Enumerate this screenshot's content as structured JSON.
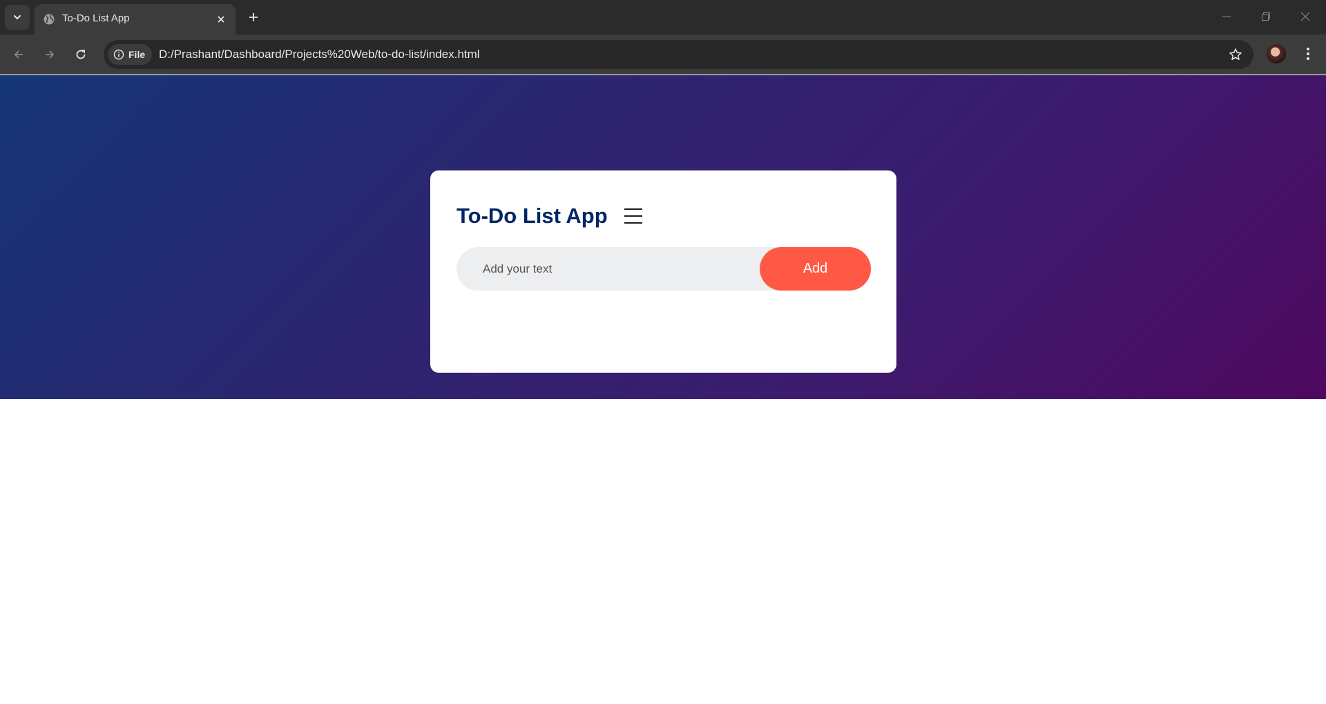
{
  "browser": {
    "tab_title": "To-Do List App",
    "site_chip_label": "File",
    "url": "D:/Prashant/Dashboard/Projects%20Web/to-do-list/index.html",
    "icons": {
      "tab_search": "chevron-down-icon",
      "favicon": "globe-icon",
      "tab_close": "close-icon",
      "new_tab": "plus-icon",
      "back": "arrow-left-icon",
      "forward": "arrow-right-icon",
      "reload": "reload-icon",
      "site_info": "info-icon",
      "bookmark": "star-icon",
      "menu": "kebab-menu-icon",
      "minimize": "minimize-icon",
      "restore": "restore-icon",
      "close_window": "close-icon"
    }
  },
  "app": {
    "title": "To-Do List App",
    "title_icon": "list-icon",
    "input_placeholder": "Add your text",
    "input_value": "",
    "add_button_label": "Add",
    "tasks": []
  },
  "colors": {
    "title": "#002765",
    "add_button": "#ff5945",
    "gradient_start": "#153677",
    "gradient_end": "#4e085f",
    "input_background": "#edeef0"
  }
}
